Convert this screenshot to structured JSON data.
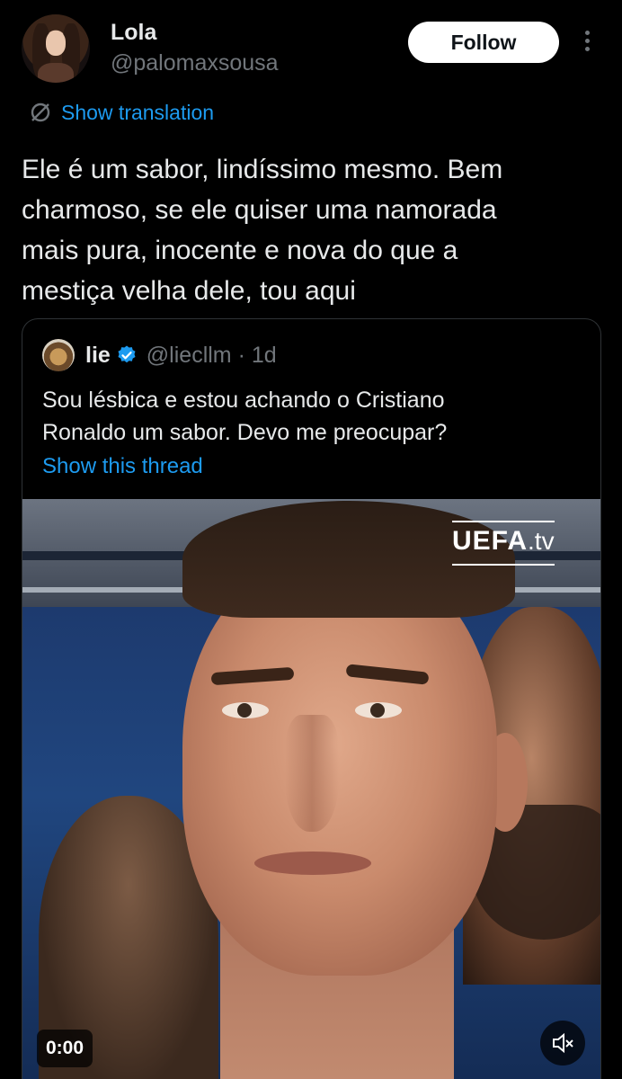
{
  "tweet": {
    "author_name": "Lola",
    "author_handle": "@palomaxsousa",
    "follow_label": "Follow",
    "translate_label": "Show translation",
    "text": "Ele é um sabor, lindíssimo mesmo. Bem\ncharmoso, se ele quiser uma namorada\nmais pura, inocente e nova do que a\nmestiça velha dele, tou aqui"
  },
  "quote": {
    "author_name": "lie",
    "author_handle": "@liecllm · 1d",
    "text": "Sou lésbica e estou achando o Cristiano\nRonaldo um sabor. Devo me preocupar?",
    "thread_label": "Show this thread",
    "media": {
      "watermark_brand": "UEFA",
      "watermark_suffix": ".tv",
      "time": "0:00"
    }
  },
  "colors": {
    "background": "#000000",
    "text": "#e7e9ea",
    "muted": "#71767b",
    "link": "#1d9bf0",
    "verified": "#1d9bf0",
    "border": "#2f3336"
  },
  "icons": [
    "more-vertical-icon",
    "translate-icon",
    "verified-badge-icon",
    "mute-icon"
  ]
}
